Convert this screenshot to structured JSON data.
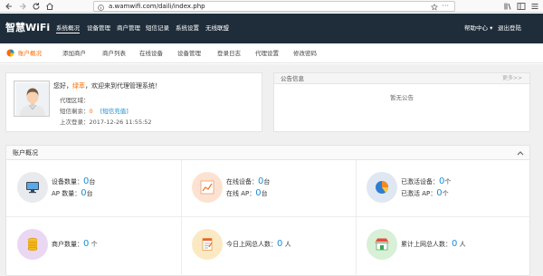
{
  "browser": {
    "url": "a.wamwifi.com/daili/index.php",
    "more_icon": "ellipsis-icon"
  },
  "topnav": {
    "logo": "智慧WiFi",
    "items": [
      {
        "label": "系统概况"
      },
      {
        "label": "设备管理"
      },
      {
        "label": "商户管理"
      },
      {
        "label": "短信记录"
      },
      {
        "label": "系统设置"
      },
      {
        "label": "无线联盟"
      }
    ],
    "help": "帮助中心 ▾",
    "logout": "退出登陆"
  },
  "subnav": {
    "items": [
      {
        "label": "账户概况"
      },
      {
        "label": "添加商户"
      },
      {
        "label": "商户列表"
      },
      {
        "label": "在线设备"
      },
      {
        "label": "设备管理"
      },
      {
        "label": "登录日志"
      },
      {
        "label": "代理设置"
      },
      {
        "label": "修改密码"
      }
    ]
  },
  "welcome": {
    "greeting_pre": "您好，",
    "user": "绿萃",
    "greeting_post": "，欢迎来到代理管理系统！",
    "area_label": "代理区域：",
    "area_value": "",
    "sms_label": "短信剩余：",
    "sms_value": "0",
    "sms_link": "[短信充值]",
    "last_login": "上次登录：2017-12-26 11:55:52"
  },
  "notice": {
    "title": "公告信息",
    "more": "更多>>",
    "empty": "暂无公告"
  },
  "account": {
    "title": "账户概况",
    "stats": [
      {
        "icon": "computer-icon",
        "lines": [
          {
            "label": "设备数量：",
            "value": "0",
            "unit": "台"
          },
          {
            "label": "AP 数量：",
            "value": "0",
            "unit": "台"
          }
        ]
      },
      {
        "icon": "line-chart-icon",
        "lines": [
          {
            "label": "在线设备：",
            "value": "0",
            "unit": "台"
          },
          {
            "label": "在线 AP：",
            "value": "0",
            "unit": "台"
          }
        ]
      },
      {
        "icon": "pie-chart-icon",
        "lines": [
          {
            "label": "已激活设备：",
            "value": "0",
            "unit": "个"
          },
          {
            "label": "已激活 AP：",
            "value": "0",
            "unit": "个"
          }
        ]
      },
      {
        "icon": "coins-icon",
        "lines": [
          {
            "label": "商户数量：",
            "value": "0",
            "unit": " 个"
          }
        ]
      },
      {
        "icon": "notepad-icon",
        "lines": [
          {
            "label": "今日上网总人数：",
            "value": "0",
            "unit": " 人"
          }
        ]
      },
      {
        "icon": "shop-icon",
        "lines": [
          {
            "label": "累计上网总人数：",
            "value": "0",
            "unit": " 人"
          }
        ]
      }
    ]
  },
  "colors": {
    "topnav_bg": "#1f2d3a",
    "accent": "#ff6a00",
    "value_blue": "#1a8ed6"
  }
}
